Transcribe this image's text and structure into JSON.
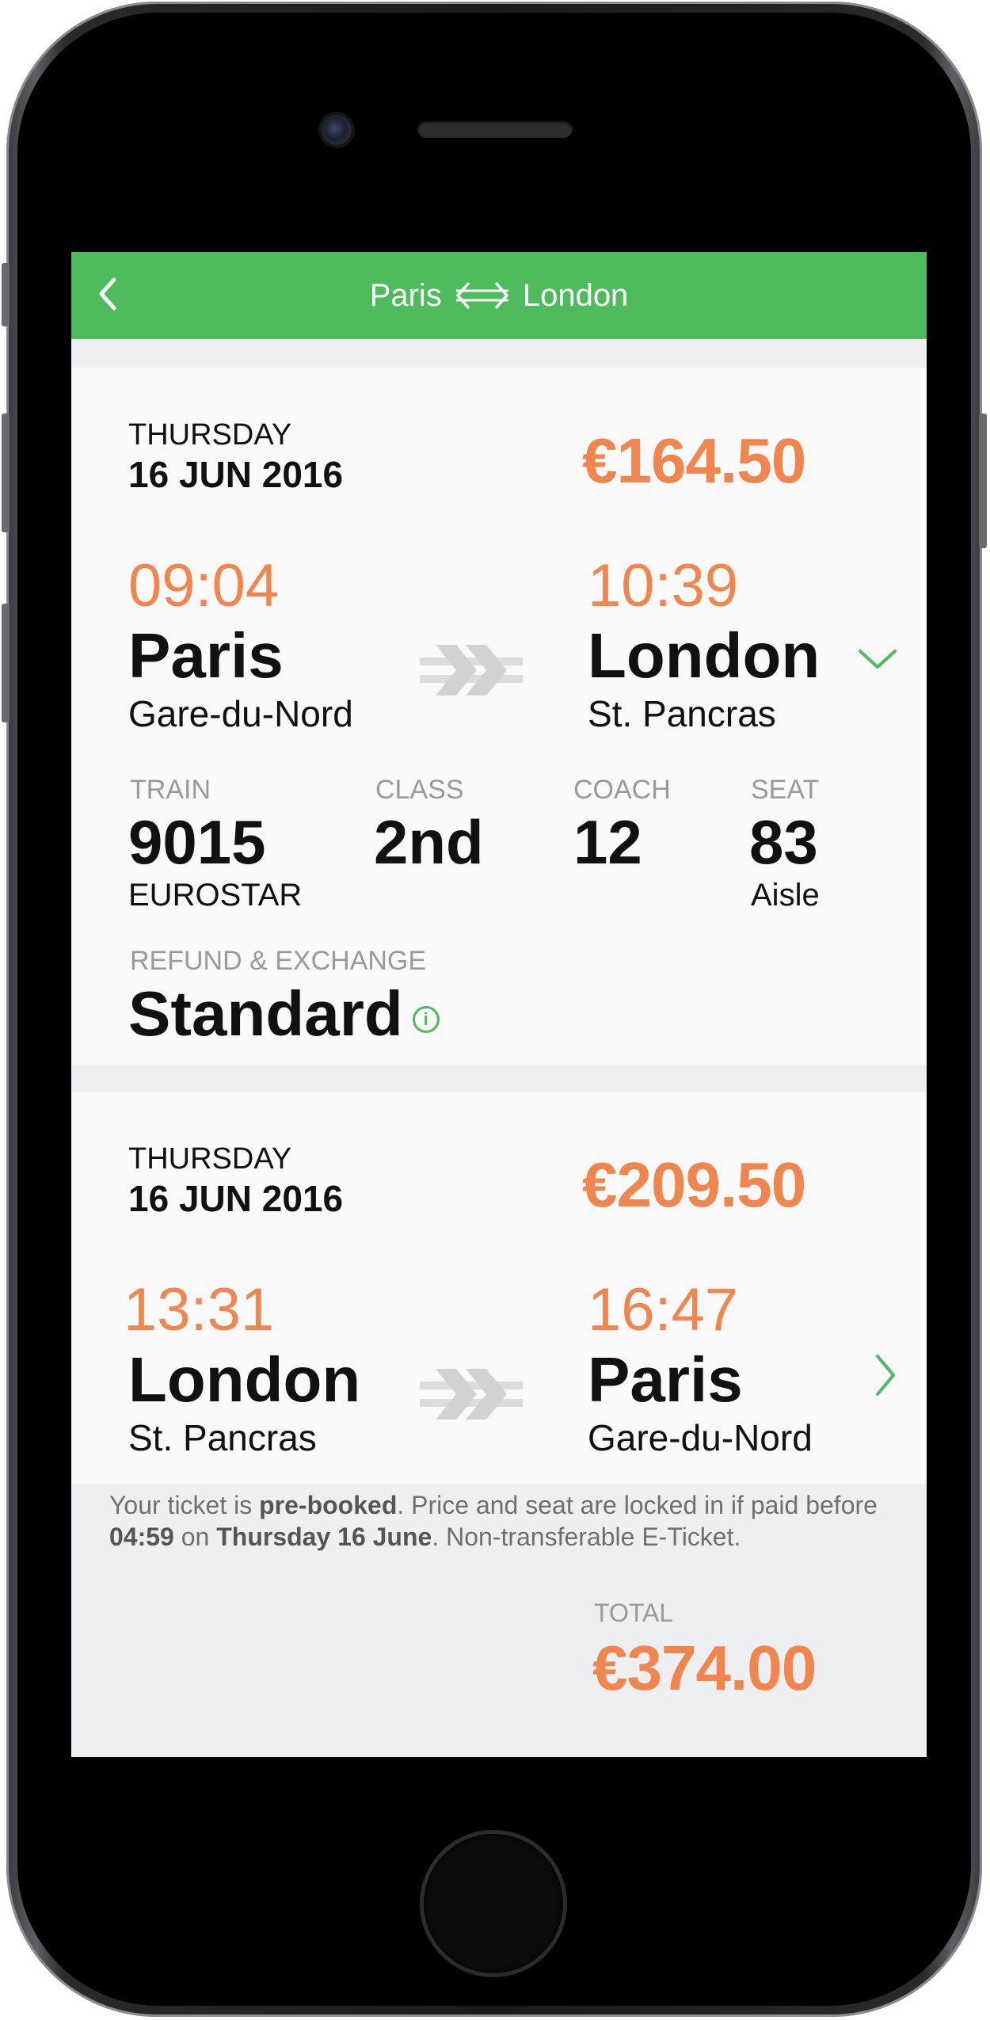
{
  "nav": {
    "origin": "Paris",
    "destination": "London"
  },
  "outbound": {
    "day": "THURSDAY",
    "date": "16 JUN 2016",
    "price": "€164.50",
    "depart_time": "09:04",
    "depart_city": "Paris",
    "depart_station": "Gare-du-Nord",
    "arrive_time": "10:39",
    "arrive_city": "London",
    "arrive_station": "St. Pancras",
    "details": {
      "train_label": "TRAIN",
      "train_value": "9015",
      "train_operator": "EUROSTAR",
      "class_label": "CLASS",
      "class_value": "2nd",
      "coach_label": "COACH",
      "coach_value": "12",
      "seat_label": "SEAT",
      "seat_value": "83",
      "seat_position": "Aisle"
    },
    "refund_label": "REFUND & EXCHANGE",
    "refund_value": "Standard"
  },
  "return": {
    "day": "THURSDAY",
    "date": "16 JUN 2016",
    "price": "€209.50",
    "depart_time": "13:31",
    "depart_city": "London",
    "depart_station": "St. Pancras",
    "arrive_time": "16:47",
    "arrive_city": "Paris",
    "arrive_station": "Gare-du-Nord"
  },
  "note": {
    "t1": "Your ticket is ",
    "b1": "pre-booked",
    "t2": ". Price and seat are locked in if paid before ",
    "b2": "04:59",
    "t3": " on ",
    "b3": "Thursday 16 June",
    "t4": ". Non-transferable E-Ticket."
  },
  "total": {
    "label": "TOTAL",
    "value": "€374.00"
  },
  "colors": {
    "accent_green": "#4ebb5c",
    "accent_orange": "#f0864d",
    "text_dark": "#111111",
    "text_muted": "#9a9a9a"
  },
  "icons": {
    "back": "chevron-left-icon",
    "swap": "swap-arrows-icon",
    "direction": "double-chevron-right-icon",
    "expand": "chevron-down-icon",
    "open": "chevron-right-icon",
    "info": "info-icon"
  }
}
